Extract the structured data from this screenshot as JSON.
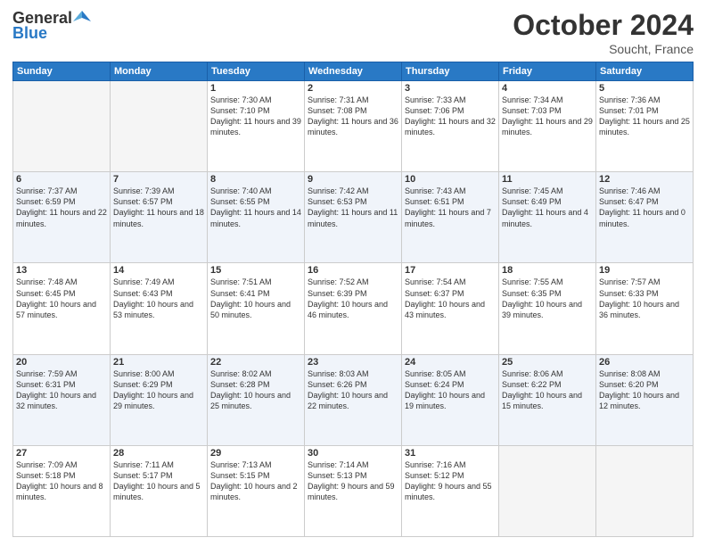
{
  "header": {
    "logo_general": "General",
    "logo_blue": "Blue",
    "month_title": "October 2024",
    "location": "Soucht, France"
  },
  "days_of_week": [
    "Sunday",
    "Monday",
    "Tuesday",
    "Wednesday",
    "Thursday",
    "Friday",
    "Saturday"
  ],
  "weeks": [
    [
      {
        "day": "",
        "sunrise": "",
        "sunset": "",
        "daylight": ""
      },
      {
        "day": "",
        "sunrise": "",
        "sunset": "",
        "daylight": ""
      },
      {
        "day": "1",
        "sunrise": "Sunrise: 7:30 AM",
        "sunset": "Sunset: 7:10 PM",
        "daylight": "Daylight: 11 hours and 39 minutes."
      },
      {
        "day": "2",
        "sunrise": "Sunrise: 7:31 AM",
        "sunset": "Sunset: 7:08 PM",
        "daylight": "Daylight: 11 hours and 36 minutes."
      },
      {
        "day": "3",
        "sunrise": "Sunrise: 7:33 AM",
        "sunset": "Sunset: 7:06 PM",
        "daylight": "Daylight: 11 hours and 32 minutes."
      },
      {
        "day": "4",
        "sunrise": "Sunrise: 7:34 AM",
        "sunset": "Sunset: 7:03 PM",
        "daylight": "Daylight: 11 hours and 29 minutes."
      },
      {
        "day": "5",
        "sunrise": "Sunrise: 7:36 AM",
        "sunset": "Sunset: 7:01 PM",
        "daylight": "Daylight: 11 hours and 25 minutes."
      }
    ],
    [
      {
        "day": "6",
        "sunrise": "Sunrise: 7:37 AM",
        "sunset": "Sunset: 6:59 PM",
        "daylight": "Daylight: 11 hours and 22 minutes."
      },
      {
        "day": "7",
        "sunrise": "Sunrise: 7:39 AM",
        "sunset": "Sunset: 6:57 PM",
        "daylight": "Daylight: 11 hours and 18 minutes."
      },
      {
        "day": "8",
        "sunrise": "Sunrise: 7:40 AM",
        "sunset": "Sunset: 6:55 PM",
        "daylight": "Daylight: 11 hours and 14 minutes."
      },
      {
        "day": "9",
        "sunrise": "Sunrise: 7:42 AM",
        "sunset": "Sunset: 6:53 PM",
        "daylight": "Daylight: 11 hours and 11 minutes."
      },
      {
        "day": "10",
        "sunrise": "Sunrise: 7:43 AM",
        "sunset": "Sunset: 6:51 PM",
        "daylight": "Daylight: 11 hours and 7 minutes."
      },
      {
        "day": "11",
        "sunrise": "Sunrise: 7:45 AM",
        "sunset": "Sunset: 6:49 PM",
        "daylight": "Daylight: 11 hours and 4 minutes."
      },
      {
        "day": "12",
        "sunrise": "Sunrise: 7:46 AM",
        "sunset": "Sunset: 6:47 PM",
        "daylight": "Daylight: 11 hours and 0 minutes."
      }
    ],
    [
      {
        "day": "13",
        "sunrise": "Sunrise: 7:48 AM",
        "sunset": "Sunset: 6:45 PM",
        "daylight": "Daylight: 10 hours and 57 minutes."
      },
      {
        "day": "14",
        "sunrise": "Sunrise: 7:49 AM",
        "sunset": "Sunset: 6:43 PM",
        "daylight": "Daylight: 10 hours and 53 minutes."
      },
      {
        "day": "15",
        "sunrise": "Sunrise: 7:51 AM",
        "sunset": "Sunset: 6:41 PM",
        "daylight": "Daylight: 10 hours and 50 minutes."
      },
      {
        "day": "16",
        "sunrise": "Sunrise: 7:52 AM",
        "sunset": "Sunset: 6:39 PM",
        "daylight": "Daylight: 10 hours and 46 minutes."
      },
      {
        "day": "17",
        "sunrise": "Sunrise: 7:54 AM",
        "sunset": "Sunset: 6:37 PM",
        "daylight": "Daylight: 10 hours and 43 minutes."
      },
      {
        "day": "18",
        "sunrise": "Sunrise: 7:55 AM",
        "sunset": "Sunset: 6:35 PM",
        "daylight": "Daylight: 10 hours and 39 minutes."
      },
      {
        "day": "19",
        "sunrise": "Sunrise: 7:57 AM",
        "sunset": "Sunset: 6:33 PM",
        "daylight": "Daylight: 10 hours and 36 minutes."
      }
    ],
    [
      {
        "day": "20",
        "sunrise": "Sunrise: 7:59 AM",
        "sunset": "Sunset: 6:31 PM",
        "daylight": "Daylight: 10 hours and 32 minutes."
      },
      {
        "day": "21",
        "sunrise": "Sunrise: 8:00 AM",
        "sunset": "Sunset: 6:29 PM",
        "daylight": "Daylight: 10 hours and 29 minutes."
      },
      {
        "day": "22",
        "sunrise": "Sunrise: 8:02 AM",
        "sunset": "Sunset: 6:28 PM",
        "daylight": "Daylight: 10 hours and 25 minutes."
      },
      {
        "day": "23",
        "sunrise": "Sunrise: 8:03 AM",
        "sunset": "Sunset: 6:26 PM",
        "daylight": "Daylight: 10 hours and 22 minutes."
      },
      {
        "day": "24",
        "sunrise": "Sunrise: 8:05 AM",
        "sunset": "Sunset: 6:24 PM",
        "daylight": "Daylight: 10 hours and 19 minutes."
      },
      {
        "day": "25",
        "sunrise": "Sunrise: 8:06 AM",
        "sunset": "Sunset: 6:22 PM",
        "daylight": "Daylight: 10 hours and 15 minutes."
      },
      {
        "day": "26",
        "sunrise": "Sunrise: 8:08 AM",
        "sunset": "Sunset: 6:20 PM",
        "daylight": "Daylight: 10 hours and 12 minutes."
      }
    ],
    [
      {
        "day": "27",
        "sunrise": "Sunrise: 7:09 AM",
        "sunset": "Sunset: 5:18 PM",
        "daylight": "Daylight: 10 hours and 8 minutes."
      },
      {
        "day": "28",
        "sunrise": "Sunrise: 7:11 AM",
        "sunset": "Sunset: 5:17 PM",
        "daylight": "Daylight: 10 hours and 5 minutes."
      },
      {
        "day": "29",
        "sunrise": "Sunrise: 7:13 AM",
        "sunset": "Sunset: 5:15 PM",
        "daylight": "Daylight: 10 hours and 2 minutes."
      },
      {
        "day": "30",
        "sunrise": "Sunrise: 7:14 AM",
        "sunset": "Sunset: 5:13 PM",
        "daylight": "Daylight: 9 hours and 59 minutes."
      },
      {
        "day": "31",
        "sunrise": "Sunrise: 7:16 AM",
        "sunset": "Sunset: 5:12 PM",
        "daylight": "Daylight: 9 hours and 55 minutes."
      },
      {
        "day": "",
        "sunrise": "",
        "sunset": "",
        "daylight": ""
      },
      {
        "day": "",
        "sunrise": "",
        "sunset": "",
        "daylight": ""
      }
    ]
  ]
}
